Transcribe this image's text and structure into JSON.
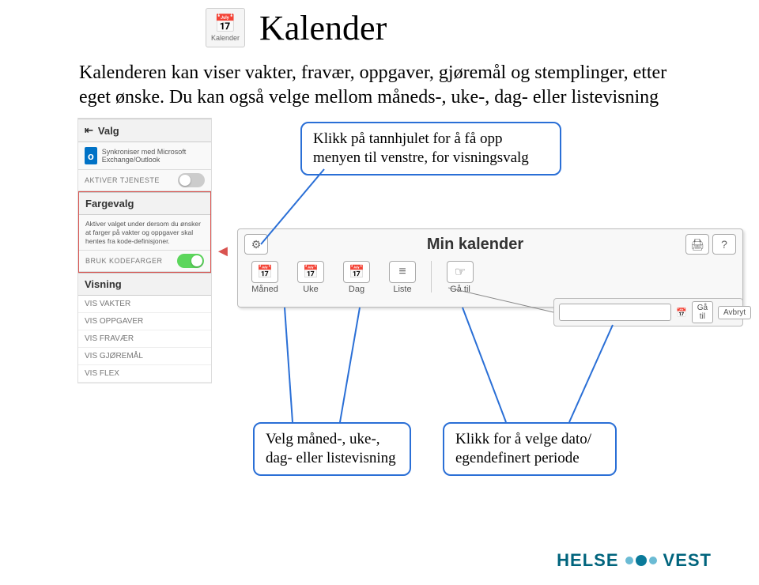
{
  "header": {
    "icon_label": "Kalender",
    "title": "Kalender"
  },
  "intro": "Kalenderen kan viser vakter, fravær, oppgaver, gjøremål og stemplinger, etter eget ønske. Du kan også velge mellom måneds-, uke-, dag- eller listevisning",
  "sidebar": {
    "title": "Valg",
    "sync_text": "Synkroniser med Microsoft Exchange/Outlook",
    "aktiver_tjeneste": "AKTIVER TJENESTE",
    "fargevalg_title": "Fargevalg",
    "fargevalg_desc": "Aktiver valget under dersom du ønsker at farger på vakter og oppgaver skal hentes fra kode-definisjoner.",
    "bruk_kodefarger": "BRUK KODEFARGER",
    "visning_title": "Visning",
    "vis_rows": [
      "VIS VAKTER",
      "VIS OPPGAVER",
      "VIS FRAVÆR",
      "VIS GJØREMÅL",
      "VIS FLEX"
    ]
  },
  "callouts": {
    "c1": "Klikk på tannhjulet for å få opp menyen til venstre, for visningsvalg",
    "c2": "Velg måned-, uke-, dag- eller listevisning",
    "c3": "Klikk for å velge dato/ egendefinert periode"
  },
  "toolbar": {
    "title": "Min kalender",
    "tabs": [
      "Måned",
      "Uke",
      "Dag",
      "Liste",
      "Gå til"
    ]
  },
  "goto_popup": {
    "btn_go": "Gå til",
    "btn_cancel": "Avbryt"
  },
  "logo": {
    "part1": "HELSE",
    "part2": "VEST"
  }
}
